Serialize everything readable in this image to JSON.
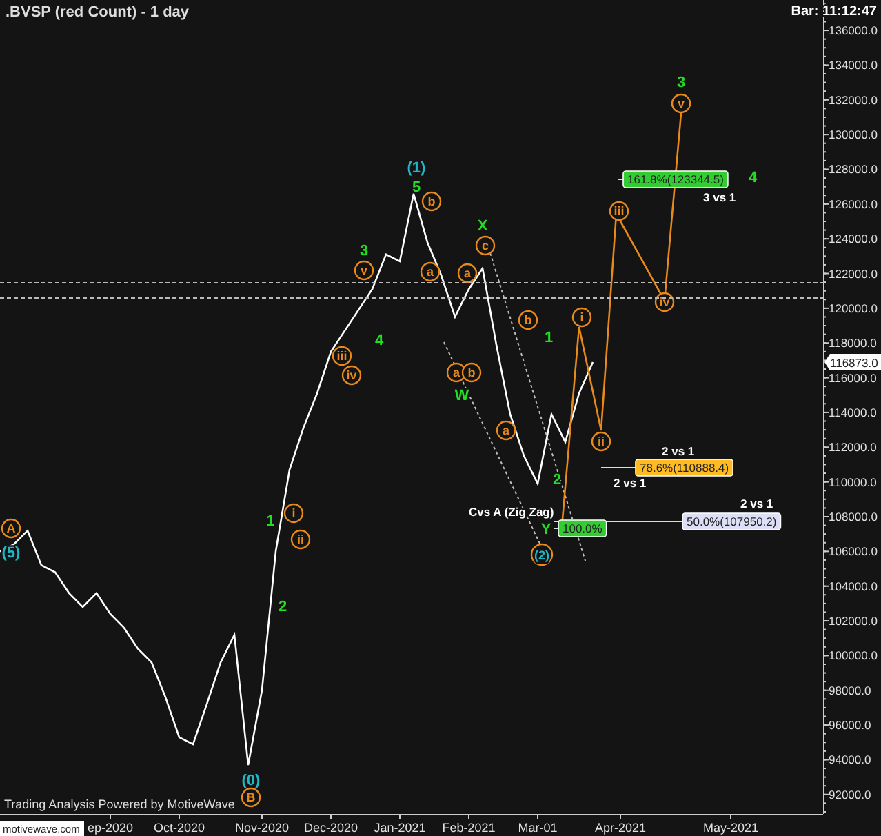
{
  "chart": {
    "title": ".BVSP (red Count) - 1 day",
    "bar_time": "Bar: 11:12:47",
    "credit": "Trading Analysis Powered by MotiveWave",
    "logo": "motivewave.com",
    "last_price": "116873.0",
    "chart_data": {
      "type": "line",
      "categories": [
        null,
        null,
        null,
        null,
        null,
        null,
        null,
        null,
        "ep-2020",
        null,
        null,
        null,
        null,
        "Oct-2020",
        null,
        null,
        null,
        null,
        null,
        "Nov-2020",
        null,
        null,
        null,
        null,
        "Dec-2020",
        null,
        null,
        null,
        null,
        "Jan-2021",
        null,
        null,
        null,
        null,
        "Feb-2021",
        null,
        null,
        null,
        null,
        "Mar-01",
        null,
        null,
        null,
        null,
        null,
        "Apr-2021",
        null,
        null,
        null,
        null,
        null,
        null,
        null,
        "May-2021",
        null,
        null,
        null,
        null,
        null,
        null
      ],
      "values": [
        106000,
        106400,
        107200,
        105200,
        104800,
        103600,
        102800,
        103600,
        102400,
        101600,
        100400,
        99600,
        97600,
        95300,
        94900,
        97200,
        99600,
        101200,
        93700,
        98000,
        106000,
        110700,
        113100,
        115100,
        117500,
        118700,
        119900,
        121100,
        123100,
        122700,
        126600,
        123800,
        121900,
        119500,
        121100,
        122300,
        117900,
        113900,
        111500,
        109900,
        113900,
        112300,
        115100,
        116900,
        null,
        null,
        null,
        null,
        null,
        null,
        null,
        null,
        null,
        null,
        null,
        null,
        null,
        null,
        null,
        null
      ],
      "ylim": [
        90880,
        137750
      ],
      "yticks": [
        {
          "value": 136000,
          "label": "136000.0"
        },
        {
          "value": 134000,
          "label": "134000.0"
        },
        {
          "value": 132000,
          "label": "132000.0"
        },
        {
          "value": 130000,
          "label": "130000.0"
        },
        {
          "value": 128000,
          "label": "128000.0"
        },
        {
          "value": 126000,
          "label": "126000.0"
        },
        {
          "value": 124000,
          "label": "124000.0"
        },
        {
          "value": 122000,
          "label": "122000.0"
        },
        {
          "value": 120000,
          "label": "120000.0"
        },
        {
          "value": 118000,
          "label": "118000.0"
        },
        {
          "value": 116000,
          "label": "116000.0"
        },
        {
          "value": 114000,
          "label": "114000.0"
        },
        {
          "value": 112000,
          "label": "112000.0"
        },
        {
          "value": 110000,
          "label": "110000.0"
        },
        {
          "value": 108000,
          "label": "108000.0"
        },
        {
          "value": 106000,
          "label": "106000.0"
        },
        {
          "value": 104000,
          "label": "104000.0"
        },
        {
          "value": 102000,
          "label": "102000.0"
        },
        {
          "value": 100000,
          "label": "100000.0"
        },
        {
          "value": 98000,
          "label": "98000.0"
        },
        {
          "value": 96000,
          "label": "96000.0"
        },
        {
          "value": 94000,
          "label": "94000.0"
        },
        {
          "value": 92000,
          "label": "92000.0"
        }
      ],
      "annotations": [
        "161.8%(123344.5)",
        "78.6%(110888.4)",
        "50.0%(107950.2)",
        "100.0%",
        "A",
        "(5)",
        "1",
        "i",
        "ii",
        "2",
        "(0)",
        "B",
        "iii",
        "iv",
        "4",
        "v",
        "3",
        "(1)",
        "5",
        "b",
        "a",
        "a",
        "X",
        "c",
        "a",
        "b",
        "W",
        "a",
        "b",
        "1",
        "2",
        "Y",
        "(2)",
        "i",
        "ii",
        "iii",
        "iv",
        "v",
        "3",
        "4",
        "3 vs 1",
        "2 vs 1",
        "2 vs 1",
        "2 vs 1",
        "Cvs A (Zig Zag)"
      ]
    }
  }
}
